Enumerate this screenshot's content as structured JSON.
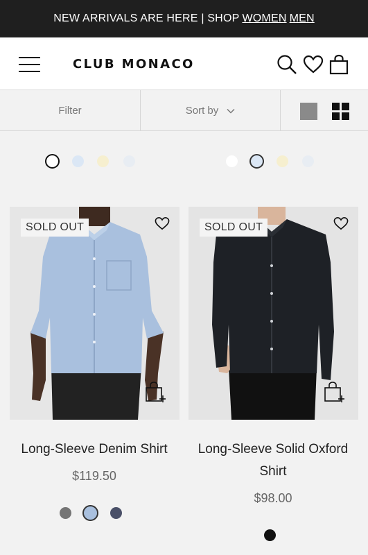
{
  "promo": {
    "text": "NEW ARRIVALS ARE HERE | SHOP",
    "link_women": "WOMEN",
    "link_men": "MEN"
  },
  "header": {
    "logo": "CLUB MONACO",
    "icons": [
      "menu-icon",
      "search-icon",
      "heart-icon",
      "bag-icon"
    ]
  },
  "toolbar": {
    "filter": "Filter",
    "sort": "Sort by"
  },
  "products": [
    {
      "name": "Long-Sleeve Denim Shirt",
      "price": "$119.50",
      "badge": "SOLD OUT",
      "colors": [
        "#757575",
        "#a9c0de",
        "#4a5068"
      ],
      "selected_color": 1
    },
    {
      "name": "Long-Sleeve Solid Oxford Shirt",
      "price": "$98.00",
      "badge": "SOLD OUT",
      "colors": [
        "#111111"
      ],
      "selected_color": 0
    }
  ],
  "top_swatches": [
    {
      "colors": [
        "#ffffff",
        "#dbe7f5",
        "#f6efcf",
        "#e8edf3"
      ],
      "selected": 0
    },
    {
      "colors": [
        "#ffffff",
        "#dbe7f5",
        "#f6efcf",
        "#e8edf3"
      ],
      "selected": 1
    }
  ]
}
